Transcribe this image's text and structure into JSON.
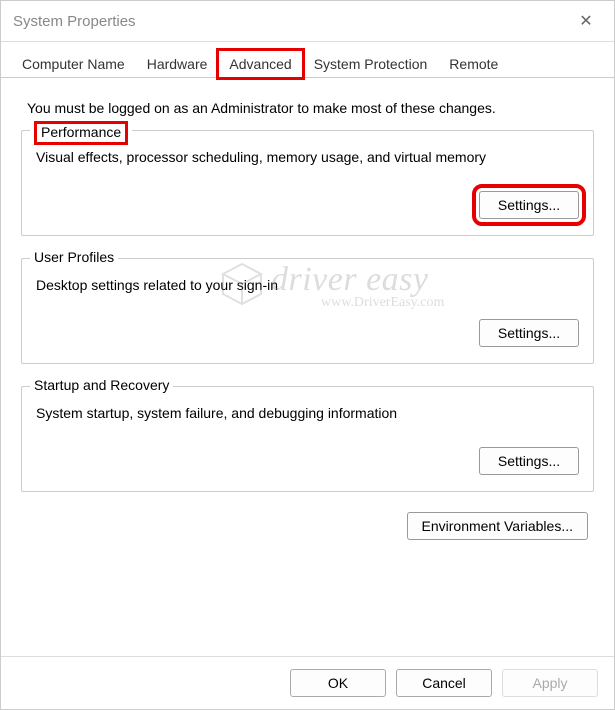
{
  "window": {
    "title": "System Properties"
  },
  "tabs": {
    "computer_name": "Computer Name",
    "hardware": "Hardware",
    "advanced": "Advanced",
    "system_protection": "System Protection",
    "remote": "Remote"
  },
  "intro_text": "You must be logged on as an Administrator to make most of these changes.",
  "sections": {
    "performance": {
      "legend": "Performance",
      "desc": "Visual effects, processor scheduling, memory usage, and virtual memory",
      "button": "Settings..."
    },
    "user_profiles": {
      "legend": "User Profiles",
      "desc": "Desktop settings related to your sign-in",
      "button": "Settings..."
    },
    "startup_recovery": {
      "legend": "Startup and Recovery",
      "desc": "System startup, system failure, and debugging information",
      "button": "Settings..."
    }
  },
  "env_button": "Environment Variables...",
  "footer": {
    "ok": "OK",
    "cancel": "Cancel",
    "apply": "Apply"
  },
  "watermark": {
    "main": "driver easy",
    "sub": "www.DriverEasy.com"
  }
}
